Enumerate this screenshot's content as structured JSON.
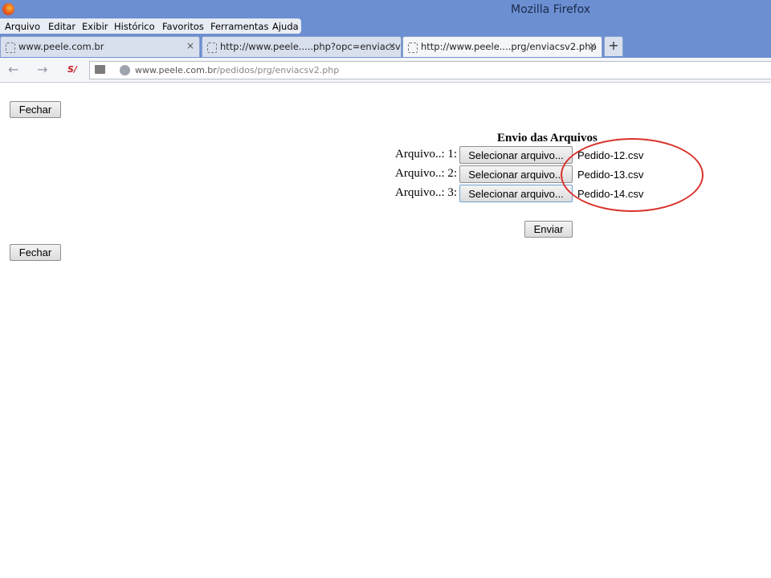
{
  "window": {
    "title": "Mozilla Firefox"
  },
  "menubar": {
    "items": [
      "Arquivo",
      "Editar",
      "Exibir",
      "Histórico",
      "Favoritos",
      "Ferramentas",
      "Ajuda"
    ]
  },
  "tabs": [
    {
      "label": "www.peele.com.br",
      "close": "×",
      "active": false
    },
    {
      "label": "http://www.peele.....php?opc=enviacsv",
      "close": "×",
      "active": false
    },
    {
      "label": "http://www.peele....prg/enviacsv2.php",
      "close": "×",
      "active": true
    }
  ],
  "newtab_label": "+",
  "navbar": {
    "url_host": "www.peele.com.br",
    "url_path": "/pedidos/prg/enviacsv2.php",
    "icons": [
      "back-arrow-icon",
      "forward-arrow-icon",
      "si-addon-icon",
      "folder-icon",
      "globe-icon"
    ]
  },
  "page": {
    "close_top_label": "Fechar",
    "close_bottom_label": "Fechar",
    "heading": "Envio das Arquivos",
    "file_rows": [
      {
        "label": "Arquivo..: 1:",
        "button": "Selecionar arquivo...",
        "file": "Pedido-12.csv"
      },
      {
        "label": "Arquivo..: 2:",
        "button": "Selecionar arquivo...",
        "file": "Pedido-13.csv"
      },
      {
        "label": "Arquivo..: 3:",
        "button": "Selecionar arquivo...",
        "file": "Pedido-14.csv"
      }
    ],
    "submit_label": "Enviar"
  },
  "colors": {
    "titlebar": "#6c8fd2",
    "annotation": "#d9312b"
  }
}
